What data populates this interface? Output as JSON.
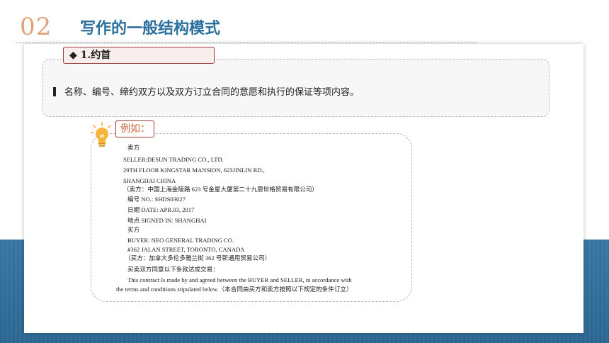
{
  "header": {
    "number": "02",
    "title": "写作的一般结构模式"
  },
  "section": {
    "label": "◆ 1.约首"
  },
  "description": "名称、编号、缔约双方以及双方订立合同的意愿和执行的保证等项内容。",
  "example": {
    "tag": "例如：",
    "lines": [
      "卖方",
      "SELLER:DESUN TRADING CO., LTD.",
      "29TH FLOOR KINGSTAR MANSION, 623JINLIN RD.,",
      "SHANGHAI CHINA",
      "（卖方：中国上海金陵路 623 号金星大厦第二十九层世格贸易有限公司）",
      "编号 NO.:       SHDS03027",
      "日期 DATE:   APR.03, 2017",
      "地点 SIGNED IN:  SHANGHAI",
      "买方",
      "BUYER: NEO GENERAL TRADING CO.",
      "#362 JALAN STREET, TORONTO, CANADA",
      "（买方：加拿大多伦多雅兰街 362 号新通用贸易公司）",
      "买卖双方同意以下条款达成交易：",
      "This contract Is made by and agreed between the BUYER and SELLER, in accordance with",
      "the terms and conditions stipulated below.（本合同由买方和卖方按照以下规定的条件订立）"
    ]
  },
  "colors": {
    "accent": "#2b6f9e",
    "number": "#e3a07a",
    "tag_border": "#9b3a3a",
    "band": "#2f6f9d"
  }
}
